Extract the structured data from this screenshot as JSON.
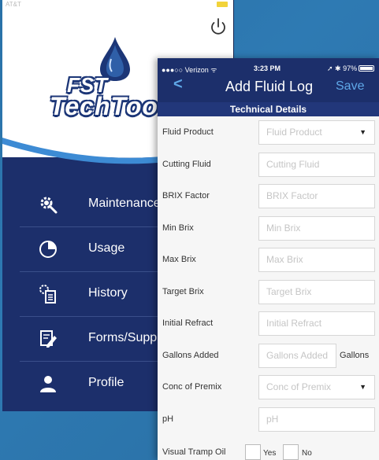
{
  "back_screen": {
    "status_carrier": "AT&T",
    "logo_top": "FST",
    "logo_bottom": "TechTool",
    "menu": [
      {
        "label": "Maintenance",
        "icon": "gear-wrench-icon"
      },
      {
        "label": "Usage",
        "icon": "pie-chart-icon"
      },
      {
        "label": "History",
        "icon": "gear-document-icon"
      },
      {
        "label": "Forms/Supp",
        "icon": "form-pencil-icon"
      },
      {
        "label": "Profile",
        "icon": "person-icon"
      }
    ]
  },
  "front_screen": {
    "status": {
      "carrier": "●●●○○ Verizon ᯤ",
      "time": "3:23 PM",
      "right": "➚ ✱ 97%",
      "battery_level": 0.97
    },
    "nav": {
      "back": "<",
      "title": "Add Fluid Log",
      "save": "Save"
    },
    "section_title": "Technical Details",
    "fields": [
      {
        "label": "Fluid Product",
        "placeholder": "Fluid Product",
        "type": "select"
      },
      {
        "label": "Cutting Fluid",
        "placeholder": "Cutting Fluid",
        "type": "text"
      },
      {
        "label": "BRIX Factor",
        "placeholder": "BRIX Factor",
        "type": "text"
      },
      {
        "label": "Min Brix",
        "placeholder": "Min Brix",
        "type": "text"
      },
      {
        "label": "Max Brix",
        "placeholder": "Max Brix",
        "type": "text"
      },
      {
        "label": "Target Brix",
        "placeholder": "Target Brix",
        "type": "text"
      },
      {
        "label": "Initial Refract",
        "placeholder": "Initial Refract",
        "type": "text"
      },
      {
        "label": "Gallons Added",
        "placeholder": "Gallons Added",
        "type": "text",
        "unit": "Gallons"
      },
      {
        "label": "Conc of Premix",
        "placeholder": "Conc of Premix",
        "type": "select"
      },
      {
        "label": "pH",
        "placeholder": "pH",
        "type": "text"
      }
    ],
    "tramp": {
      "label": "Visual Tramp Oil",
      "yes": "Yes",
      "no": "No"
    }
  },
  "colors": {
    "navy": "#1c2f6b",
    "section": "#22377a",
    "accent": "#5fa8e8",
    "background": "#2e7ab3"
  }
}
